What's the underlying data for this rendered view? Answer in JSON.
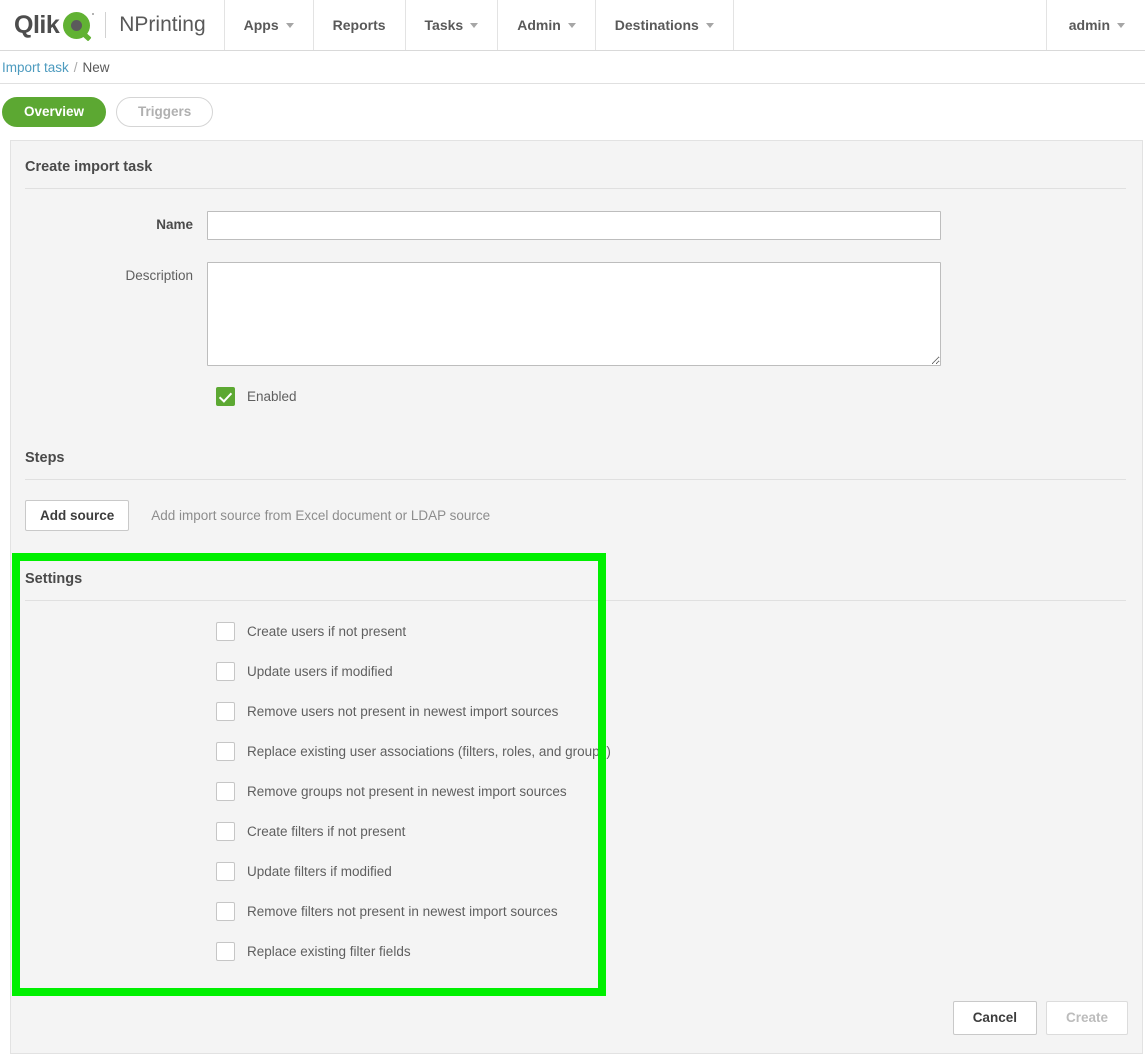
{
  "nav": {
    "brand_name": "Qlik",
    "product": "NPrinting",
    "items": [
      {
        "label": "Apps",
        "has_caret": true
      },
      {
        "label": "Reports",
        "has_caret": false
      },
      {
        "label": "Tasks",
        "has_caret": true
      },
      {
        "label": "Admin",
        "has_caret": true
      },
      {
        "label": "Destinations",
        "has_caret": true
      }
    ],
    "user": "admin"
  },
  "breadcrumb": {
    "link": "Import task",
    "separator": "/",
    "current": "New"
  },
  "tabs": [
    {
      "label": "Overview",
      "active": true
    },
    {
      "label": "Triggers",
      "active": false
    }
  ],
  "form": {
    "title": "Create import task",
    "name_label": "Name",
    "name_value": "",
    "name_placeholder": "",
    "description_label": "Description",
    "description_value": "",
    "description_placeholder": "",
    "enabled_label": "Enabled",
    "enabled_checked": true
  },
  "steps": {
    "title": "Steps",
    "add_source_label": "Add source",
    "hint": "Add import source from Excel document or LDAP source"
  },
  "settings": {
    "title": "Settings",
    "options": [
      {
        "label": "Create users if not present",
        "checked": false
      },
      {
        "label": "Update users if modified",
        "checked": false
      },
      {
        "label": "Remove users not present in newest import sources",
        "checked": false
      },
      {
        "label": "Replace existing user associations (filters, roles, and groups)",
        "checked": false
      },
      {
        "label": "Remove groups not present in newest import sources",
        "checked": false
      },
      {
        "label": "Create filters if not present",
        "checked": false
      },
      {
        "label": "Update filters if modified",
        "checked": false
      },
      {
        "label": "Remove filters not present in newest import sources",
        "checked": false
      },
      {
        "label": "Replace existing filter fields",
        "checked": false
      }
    ]
  },
  "footer": {
    "cancel_label": "Cancel",
    "create_label": "Create",
    "create_disabled": true
  },
  "colors": {
    "brand_green": "#61b233",
    "accent_green": "#5ca832",
    "highlight_green": "#00f000",
    "link_blue": "#4d9bbf",
    "panel_bg": "#f4f4f4"
  }
}
